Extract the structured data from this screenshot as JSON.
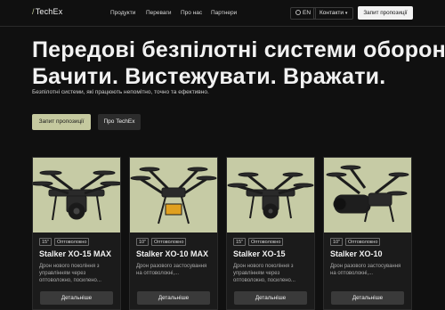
{
  "header": {
    "logo": "TechEx",
    "nav": [
      "Продукти",
      "Переваги",
      "Про нас",
      "Партнери"
    ],
    "lang": "EN",
    "contacts": "Контакти",
    "request": "Запит пропозиції"
  },
  "hero": {
    "title_line1": "Передові безпілотні системи оборони",
    "title_line2": "Бачити. Вистежувати. Вражати.",
    "subtitle": "Безпілотні системи, які працюють непомітно, точно та ефективно.",
    "primary_button": "Запит пропозиції",
    "secondary_button": "Про TechEx"
  },
  "products": [
    {
      "tag1": "15\"",
      "tag2": "Оптоволокно",
      "title": "Stalker XO-15 MAX",
      "desc": "Дрон нового покоління з управлінням через оптоволокно, посилено...",
      "button": "Детальніше"
    },
    {
      "tag1": "10\"",
      "tag2": "Оптоволокно",
      "title": "Stalker XO-10 MAX",
      "desc": "Дрон разового застосування на оптоволокні,...",
      "button": "Детальніше"
    },
    {
      "tag1": "15\"",
      "tag2": "Оптоволокно",
      "title": "Stalker XO-15",
      "desc": "Дрон нового покоління з управлінням через оптоволокно, посилено...",
      "button": "Детальніше"
    },
    {
      "tag1": "10\"",
      "tag2": "Оптоволокно",
      "title": "Stalker XO-10",
      "desc": "Дрон разового застосування на оптоволокні,...",
      "button": "Детальніше"
    }
  ]
}
